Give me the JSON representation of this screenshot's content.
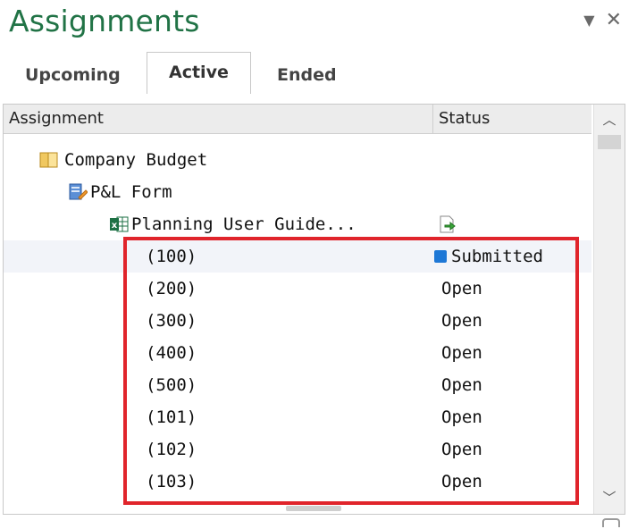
{
  "panel": {
    "title": "Assignments"
  },
  "tabs": [
    "Upcoming",
    "Active",
    "Ended"
  ],
  "columns": {
    "assignment": "Assignment",
    "status": "Status"
  },
  "tree": {
    "company": "Company Budget",
    "form": "P&L Form",
    "guide": "Planning User Guide..."
  },
  "rows": [
    {
      "entity": "(100)",
      "status": "Submitted"
    },
    {
      "entity": "(200)",
      "status": "Open"
    },
    {
      "entity": "(300)",
      "status": "Open"
    },
    {
      "entity": "(400)",
      "status": "Open"
    },
    {
      "entity": "(500)",
      "status": "Open"
    },
    {
      "entity": "(101)",
      "status": "Open"
    },
    {
      "entity": "(102)",
      "status": "Open"
    },
    {
      "entity": "(103)",
      "status": "Open"
    }
  ],
  "colors": {
    "title": "#217346",
    "highlight": "#e0242b",
    "submitted": "#1e78d6"
  }
}
